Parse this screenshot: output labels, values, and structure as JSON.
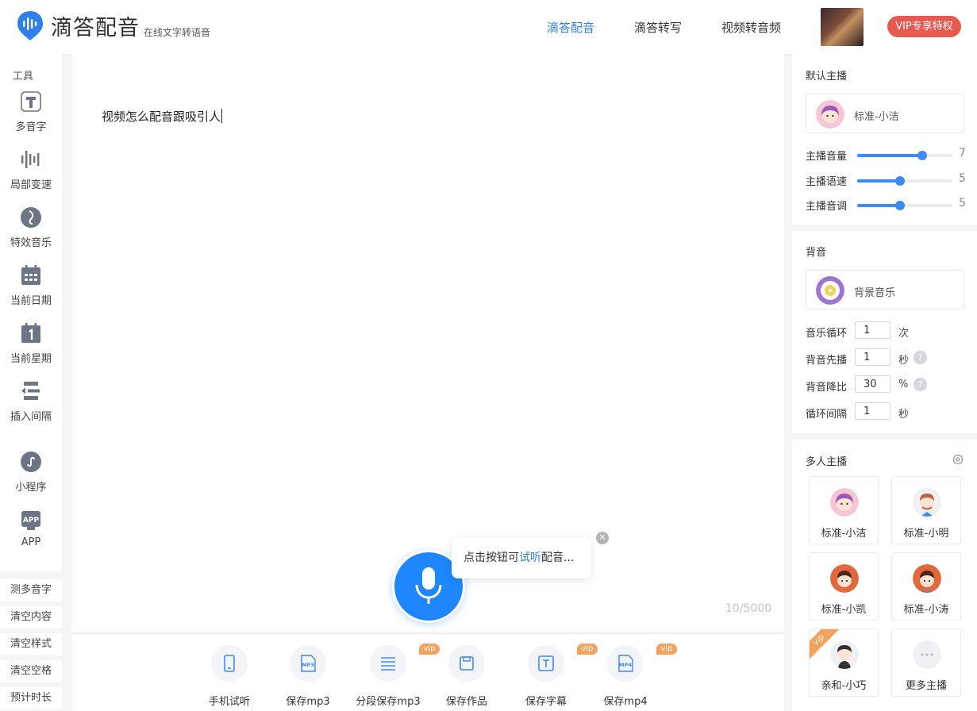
{
  "header": {
    "brand": "滴答配音",
    "brand_sub": "在线文字转语音",
    "nav": [
      "滴答配音",
      "滴答转写",
      "视频转音频"
    ],
    "vip": "VIP专享特权",
    "accent": "#2f80ed",
    "vip_color": "#e85a4f"
  },
  "sidebar": {
    "title": "工具",
    "tools": [
      {
        "label": "多音字",
        "icon": "polyphone-icon"
      },
      {
        "label": "局部变速",
        "icon": "waveform-icon"
      },
      {
        "label": "特效音乐",
        "icon": "music-effect-icon"
      },
      {
        "label": "当前日期",
        "icon": "calendar-icon"
      },
      {
        "label": "当前星期",
        "icon": "weekday-icon"
      },
      {
        "label": "插入间隔",
        "icon": "interval-icon"
      },
      {
        "label": "小程序",
        "icon": "miniprogram-icon"
      },
      {
        "label": "APP",
        "icon": "app-icon"
      }
    ],
    "buttons": [
      "测多音字",
      "清空内容",
      "清空样式",
      "清空空格",
      "预计时长"
    ]
  },
  "editor": {
    "text": "视频怎么配音跟吸引人",
    "counter": "10/5000",
    "tip_before": "点击按钮可",
    "tip_link": "试听",
    "tip_after": "配音..."
  },
  "toolbar": [
    {
      "label": "手机试听",
      "icon": "phone-icon",
      "vip": false
    },
    {
      "label": "保存mp3",
      "icon": "mp3-icon",
      "vip": false
    },
    {
      "label": "分段保存mp3",
      "icon": "list-icon",
      "vip": true
    },
    {
      "label": "保存作品",
      "icon": "save-icon",
      "vip": false
    },
    {
      "label": "保存字幕",
      "icon": "subtitle-icon",
      "vip": true
    },
    {
      "label": "保存mp4",
      "icon": "mp4-icon",
      "vip": true
    }
  ],
  "vip_tag": "vip",
  "default_anchor": {
    "title": "默认主播",
    "name": "标准-小洁",
    "sliders": [
      {
        "label": "主播音量",
        "value": 7,
        "fraction": 0.68
      },
      {
        "label": "主播语速",
        "value": 5,
        "fraction": 0.45
      },
      {
        "label": "主播音调",
        "value": 5,
        "fraction": 0.45
      }
    ]
  },
  "background": {
    "title": "背音",
    "name": "背景音乐",
    "rows": [
      {
        "label": "音乐循环",
        "value": "1",
        "unit": "次",
        "help": false
      },
      {
        "label": "背音先播",
        "value": "1",
        "unit": "秒",
        "help": true
      },
      {
        "label": "背音降比",
        "value": "30",
        "unit": "%",
        "help": true
      },
      {
        "label": "循环间隔",
        "value": "1",
        "unit": "秒",
        "help": false
      }
    ]
  },
  "multi_anchor": {
    "title": "多人主播",
    "cards": [
      {
        "name": "标准-小洁",
        "vip": false
      },
      {
        "name": "标准-小明",
        "vip": false
      },
      {
        "name": "标准-小凯",
        "vip": false
      },
      {
        "name": "标准-小涛",
        "vip": false
      },
      {
        "name": "亲和-小巧",
        "vip": true
      },
      {
        "name": "更多主播",
        "vip": false
      }
    ]
  }
}
